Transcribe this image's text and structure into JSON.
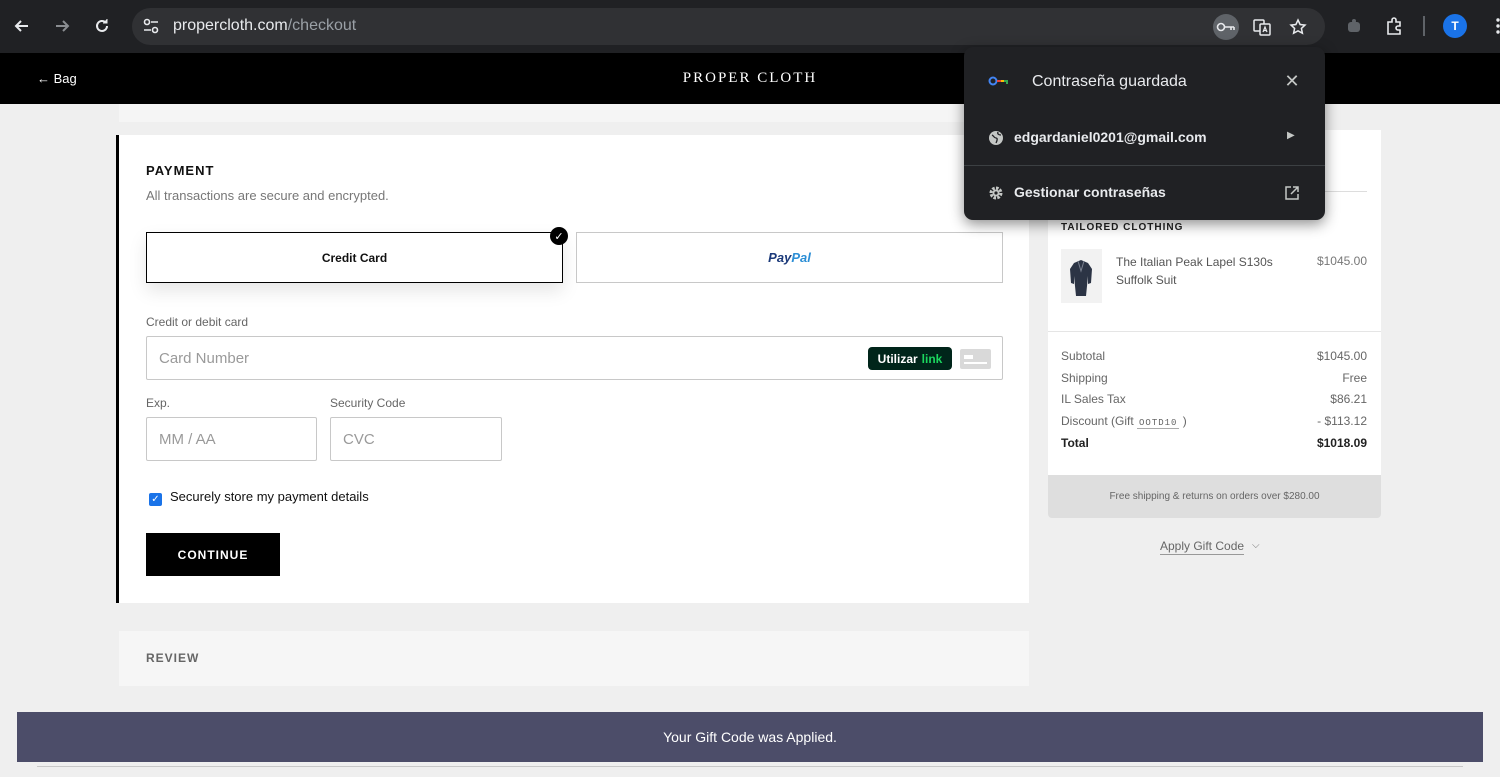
{
  "browser": {
    "url_host": "propercloth.com",
    "url_path": "/checkout",
    "profile_initial": "T"
  },
  "site": {
    "back_label": "← Bag",
    "brand": "PROPER CLOTH"
  },
  "payment": {
    "heading": "PAYMENT",
    "subheading": "All transactions are secure and encrypted.",
    "methods": {
      "credit_card": "Credit Card",
      "paypal_part1": "Pay",
      "paypal_part2": "Pal"
    },
    "card_label": "Credit or debit card",
    "card_placeholder": "Card Number",
    "link_button": {
      "prefix": "Utilizar",
      "brand": "link"
    },
    "exp_label": "Exp.",
    "exp_placeholder": "MM / AA",
    "cvc_label": "Security Code",
    "cvc_placeholder": "CVC",
    "store_label": "Securely store my payment details",
    "store_checked": true,
    "continue_label": "CONTINUE"
  },
  "review": {
    "heading": "REVIEW"
  },
  "summary": {
    "section": "TAILORED CLOTHING",
    "item": {
      "name": "The Italian Peak Lapel S130s Suffolk Suit",
      "price": "$1045.00"
    },
    "rows": {
      "subtotal": {
        "label": "Subtotal",
        "value": "$1045.00"
      },
      "shipping": {
        "label": "Shipping",
        "value": "Free"
      },
      "tax": {
        "label": "IL Sales Tax",
        "value": "$86.21"
      },
      "discount": {
        "label_prefix": "Discount (Gift",
        "code": "OOTD10",
        "label_suffix": ")",
        "value": "- $113.12"
      },
      "total": {
        "label": "Total",
        "value": "$1018.09"
      }
    },
    "free_shipping_note": "Free shipping & returns on orders over $280.00",
    "apply_gift_label": "Apply Gift Code"
  },
  "password_popup": {
    "title": "Contraseña guardada",
    "account": "edgardaniel0201@gmail.com",
    "manage": "Gestionar contraseñas"
  },
  "toast": {
    "message": "Your Gift Code was Applied."
  },
  "colors": {
    "toast_bg": "#4c4d69",
    "checkbox": "#1a73e8",
    "link_green": "#1bd65e",
    "paypal_dark": "#1c3a7a",
    "paypal_light": "#2d8fd6"
  }
}
